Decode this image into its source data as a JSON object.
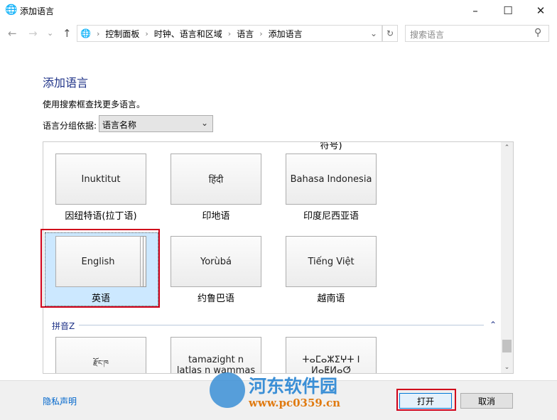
{
  "window": {
    "title": "添加语言",
    "minimize": "–",
    "maximize": "☐",
    "close": "✕"
  },
  "nav": {
    "back": "←",
    "forward": "→",
    "recent": "⌄",
    "up": "↑",
    "breadcrumb": [
      "控制面板",
      "时钟、语言和区域",
      "语言",
      "添加语言"
    ],
    "dropdown": "⌄",
    "refresh": "↻",
    "search_placeholder": "搜索语言",
    "search_icon": "⚲"
  },
  "main": {
    "heading": "添加语言",
    "hint": "使用搜索框查找更多语言。",
    "group_label": "语言分组依据:",
    "group_value": "语言名称",
    "partial_top": "符号)"
  },
  "tiles": [
    {
      "name": "Inuktitut",
      "label": "因纽特语(拉丁语)"
    },
    {
      "name": "हिंदी",
      "label": "印地语"
    },
    {
      "name": "Bahasa Indonesia",
      "label": "印度尼西亚语"
    },
    {
      "name": "English",
      "label": "英语"
    },
    {
      "name": "Yorùbá",
      "label": "约鲁巴语"
    },
    {
      "name": "Tiếng Việt",
      "label": "越南语"
    }
  ],
  "section": {
    "title": "拼音Z",
    "collapse": "⌃"
  },
  "tiles2": [
    {
      "name": "རྫོང་ཁ"
    },
    {
      "name": "tamazight n laṭlaṣ n wammas"
    },
    {
      "name": "ⵜⴰⵎⴰⵣⵉⵖⵜ ⵏ ⵍⴰⵟⵍⴰⵚ"
    }
  ],
  "footer": {
    "privacy": "隐私声明",
    "open": "打开",
    "cancel": "取消"
  },
  "watermark": {
    "name": "河东软件园",
    "url": "www.pc0359.cn"
  },
  "colors": {
    "heading": "#1e3287",
    "link": "#0066cc",
    "selection": "#cce8ff",
    "highlight_box": "#d0021b"
  }
}
